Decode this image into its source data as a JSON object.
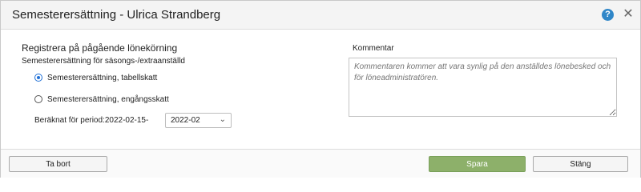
{
  "dialog": {
    "title": "Semesterersättning - Ulrica Strandberg",
    "help_symbol": "?",
    "close_symbol": "✕"
  },
  "form": {
    "heading": "Registrera på pågående lönekörning",
    "subheading": "Semesterersättning för säsongs-/extraanställd",
    "options": [
      {
        "label": "Semesterersättning, tabellskatt",
        "selected": true
      },
      {
        "label": "Semesterersättning, engångsskatt",
        "selected": false
      }
    ],
    "period_label": "Beräknat för period:2022-02-15-",
    "period_value": "2022-02",
    "period_chevron": "⌄"
  },
  "comment": {
    "label": "Kommentar",
    "placeholder": "Kommentaren kommer att vara synlig på den anställdes lönebesked och för löneadministratören."
  },
  "footer": {
    "delete_label": "Ta bort",
    "save_label": "Spara",
    "close_label": "Stäng"
  },
  "colors": {
    "save_button": "#8db06a",
    "help_icon": "#2f86c8",
    "radio_selected": "#1f6fd6"
  }
}
